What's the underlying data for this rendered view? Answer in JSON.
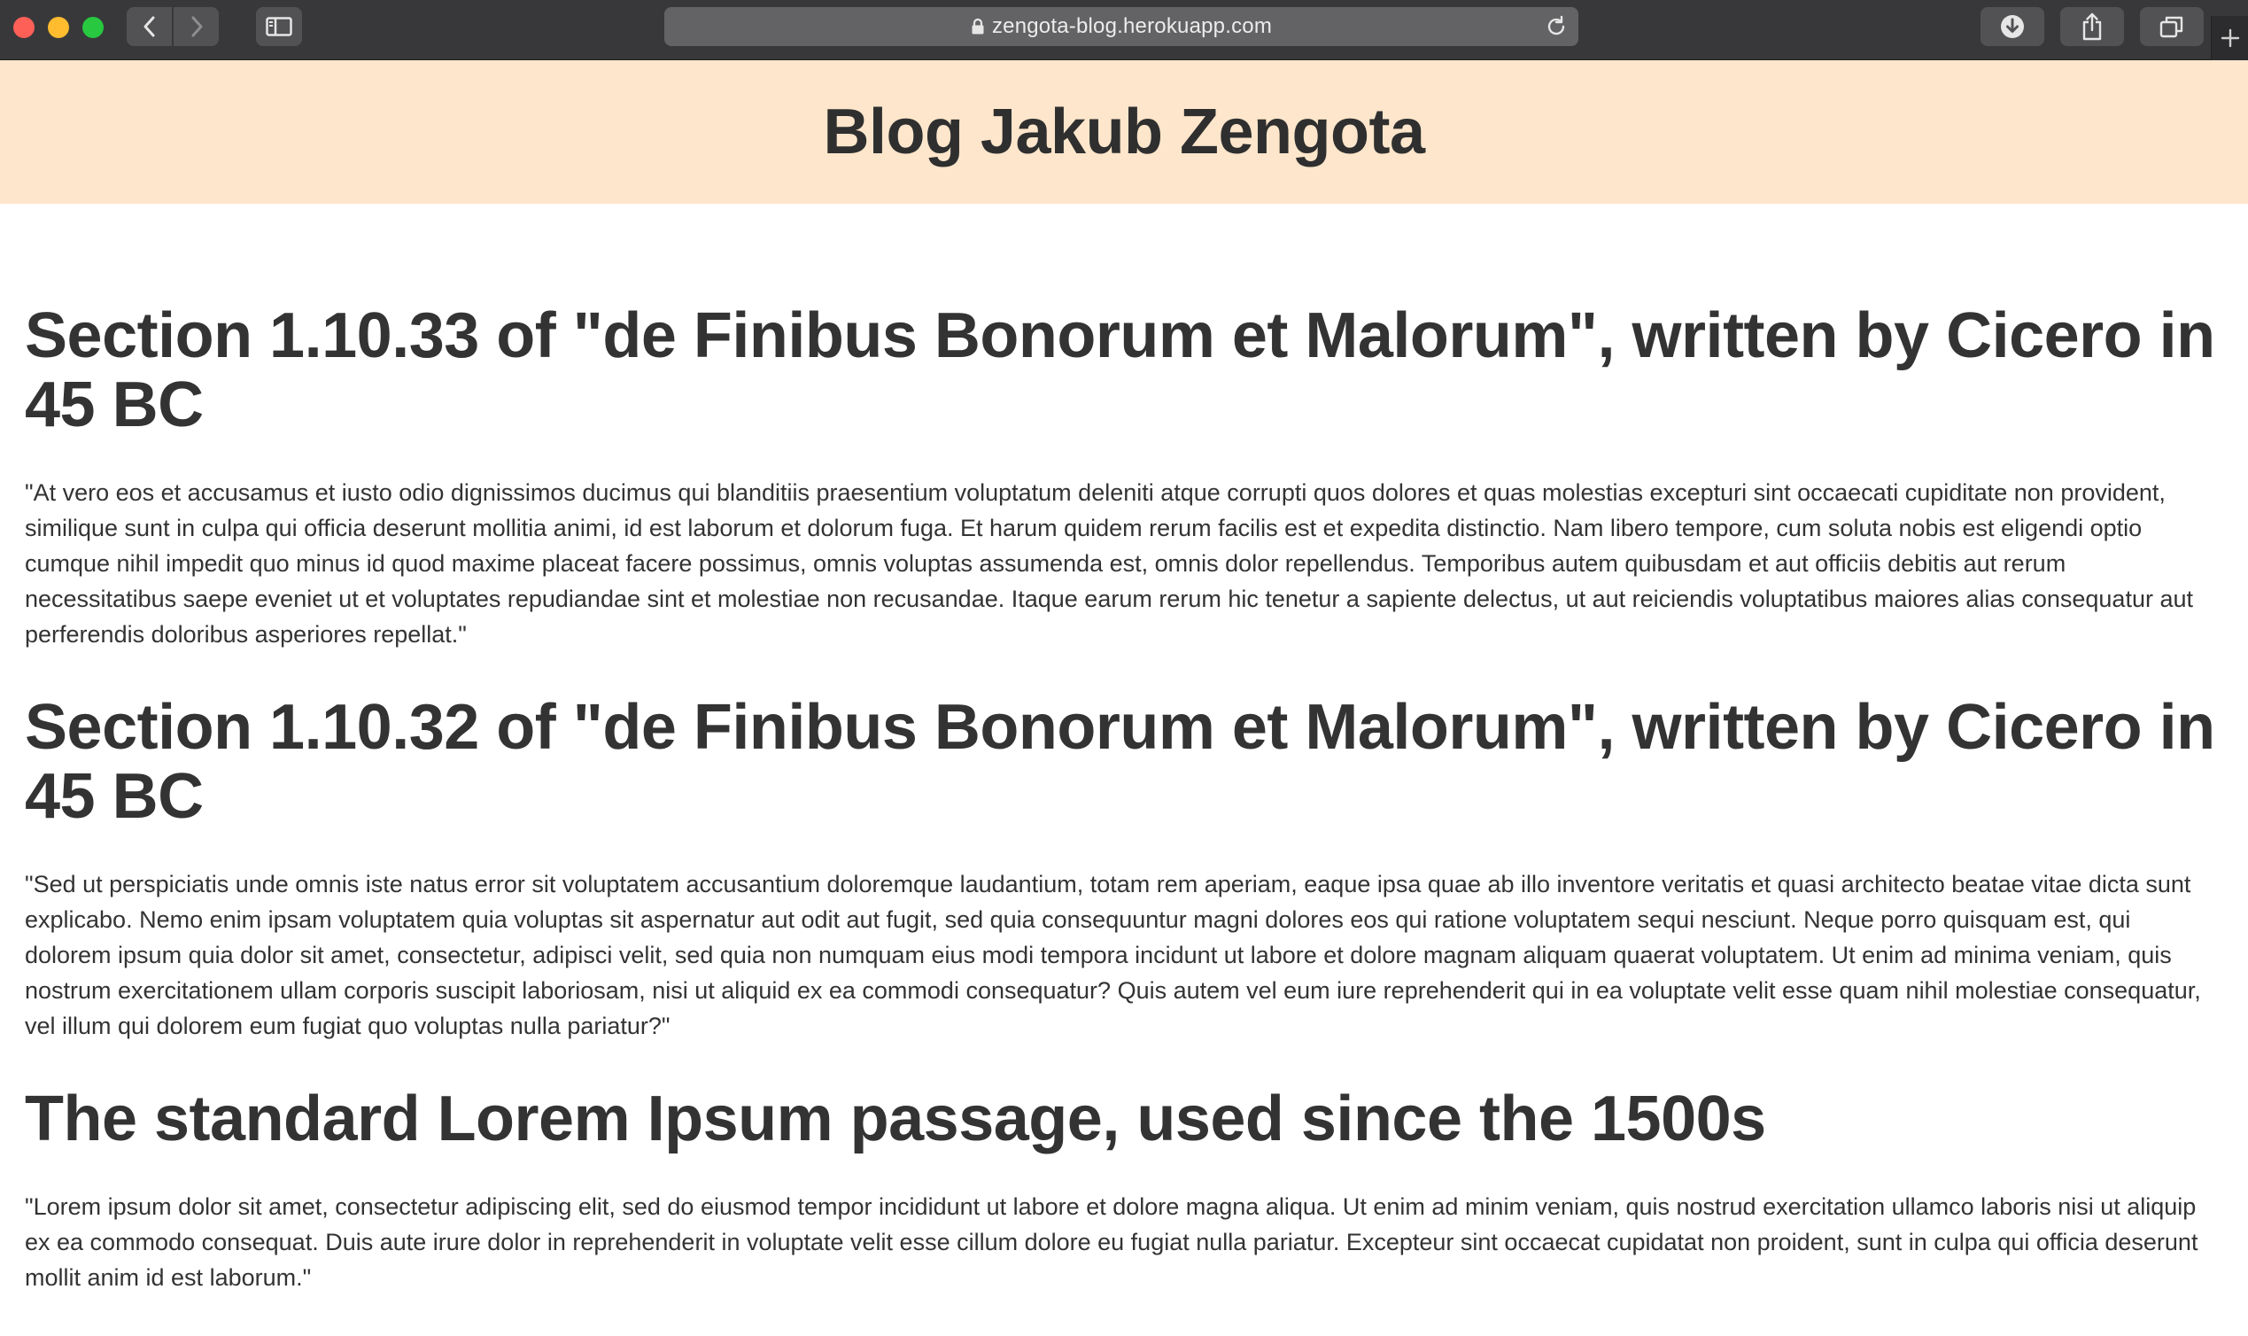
{
  "browser": {
    "url": "zengota-blog.herokuapp.com",
    "icons": [
      "back-icon",
      "forward-icon",
      "sidebar-icon",
      "lock-icon",
      "reload-icon",
      "download-icon",
      "share-icon",
      "tabs-icon",
      "plus-icon"
    ],
    "colors": {
      "toolbar": "#38383a",
      "address_bar": "#636365",
      "close": "#fe5f57",
      "minimize": "#febc2e",
      "zoom": "#28c840"
    }
  },
  "site": {
    "title": "Blog Jakub Zengota",
    "header_bg": "#fde6cb"
  },
  "posts": [
    {
      "title": "Section 1.10.33 of \"de Finibus Bonorum et Malorum\", written by Cicero in 45 BC",
      "body": "\"At vero eos et accusamus et iusto odio dignissimos ducimus qui blanditiis praesentium voluptatum deleniti atque corrupti quos dolores et quas molestias excepturi sint occaecati cupiditate non provident, similique sunt in culpa qui officia deserunt mollitia animi, id est laborum et dolorum fuga. Et harum quidem rerum facilis est et expedita distinctio. Nam libero tempore, cum soluta nobis est eligendi optio cumque nihil impedit quo minus id quod maxime placeat facere possimus, omnis voluptas assumenda est, omnis dolor repellendus. Temporibus autem quibusdam et aut officiis debitis aut rerum necessitatibus saepe eveniet ut et voluptates repudiandae sint et molestiae non recusandae. Itaque earum rerum hic tenetur a sapiente delectus, ut aut reiciendis voluptatibus maiores alias consequatur aut perferendis doloribus asperiores repellat.\""
    },
    {
      "title": "Section 1.10.32 of \"de Finibus Bonorum et Malorum\", written by Cicero in 45 BC",
      "body": "\"Sed ut perspiciatis unde omnis iste natus error sit voluptatem accusantium doloremque laudantium, totam rem aperiam, eaque ipsa quae ab illo inventore veritatis et quasi architecto beatae vitae dicta sunt explicabo. Nemo enim ipsam voluptatem quia voluptas sit aspernatur aut odit aut fugit, sed quia consequuntur magni dolores eos qui ratione voluptatem sequi nesciunt. Neque porro quisquam est, qui dolorem ipsum quia dolor sit amet, consectetur, adipisci velit, sed quia non numquam eius modi tempora incidunt ut labore et dolore magnam aliquam quaerat voluptatem. Ut enim ad minima veniam, quis nostrum exercitationem ullam corporis suscipit laboriosam, nisi ut aliquid ex ea commodi consequatur? Quis autem vel eum iure reprehenderit qui in ea voluptate velit esse quam nihil molestiae consequatur, vel illum qui dolorem eum fugiat quo voluptas nulla pariatur?\""
    },
    {
      "title": "The standard Lorem Ipsum passage, used since the 1500s",
      "body": "\"Lorem ipsum dolor sit amet, consectetur adipiscing elit, sed do eiusmod tempor incididunt ut labore et dolore magna aliqua. Ut enim ad minim veniam, quis nostrud exercitation ullamco laboris nisi ut aliquip ex ea commodo consequat. Duis aute irure dolor in reprehenderit in voluptate velit esse cillum dolore eu fugiat nulla pariatur. Excepteur sint occaecat cupidatat non proident, sunt in culpa qui officia deserunt mollit anim id est laborum.\""
    }
  ]
}
